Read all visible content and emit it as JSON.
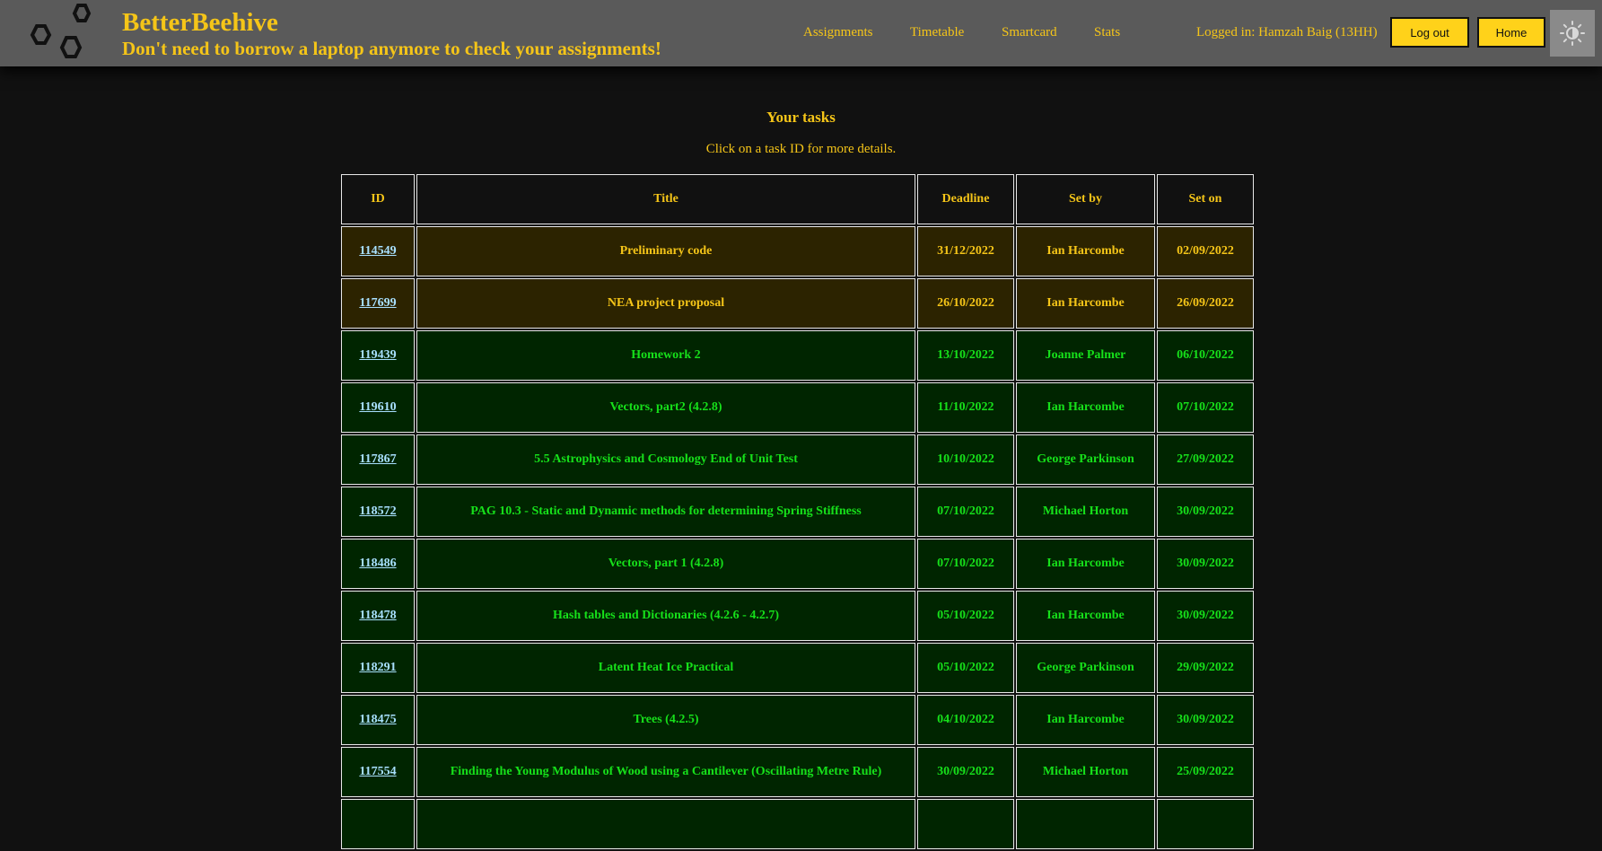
{
  "header": {
    "title": "BetterBeehive",
    "subtitle": "Don't need to borrow a laptop anymore to check your assignments!",
    "logo_icon": "hexagon-cluster-logo-icon",
    "nav": [
      "Assignments",
      "Timetable",
      "Smartcard",
      "Stats"
    ],
    "login_text": "Logged in: Hamzah Baig (13HH)",
    "logout_label": "Log out",
    "home_label": "Home",
    "theme_icon": "sun-moon-theme-icon"
  },
  "main": {
    "heading": "Your tasks",
    "instruction": "Click on a task ID for more details."
  },
  "table": {
    "columns": [
      "ID",
      "Title",
      "Deadline",
      "Set by",
      "Set on"
    ],
    "rows": [
      {
        "id": "114549",
        "title": "Preliminary code",
        "deadline": "31/12/2022",
        "set_by": "Ian Harcombe",
        "set_on": "02/09/2022",
        "status": "amber"
      },
      {
        "id": "117699",
        "title": "NEA project proposal",
        "deadline": "26/10/2022",
        "set_by": "Ian Harcombe",
        "set_on": "26/09/2022",
        "status": "amber"
      },
      {
        "id": "119439",
        "title": "Homework 2",
        "deadline": "13/10/2022",
        "set_by": "Joanne Palmer",
        "set_on": "06/10/2022",
        "status": "green"
      },
      {
        "id": "119610",
        "title": "Vectors, part2 (4.2.8)",
        "deadline": "11/10/2022",
        "set_by": "Ian Harcombe",
        "set_on": "07/10/2022",
        "status": "green"
      },
      {
        "id": "117867",
        "title": "5.5 Astrophysics and Cosmology End of Unit Test",
        "deadline": "10/10/2022",
        "set_by": "George Parkinson",
        "set_on": "27/09/2022",
        "status": "green"
      },
      {
        "id": "118572",
        "title": "PAG 10.3 - Static and Dynamic methods for determining Spring Stiffness",
        "deadline": "07/10/2022",
        "set_by": "Michael Horton",
        "set_on": "30/09/2022",
        "status": "green"
      },
      {
        "id": "118486",
        "title": "Vectors, part 1 (4.2.8)",
        "deadline": "07/10/2022",
        "set_by": "Ian Harcombe",
        "set_on": "30/09/2022",
        "status": "green"
      },
      {
        "id": "118478",
        "title": "Hash tables and Dictionaries (4.2.6 - 4.2.7)",
        "deadline": "05/10/2022",
        "set_by": "Ian Harcombe",
        "set_on": "30/09/2022",
        "status": "green"
      },
      {
        "id": "118291",
        "title": "Latent Heat Ice Practical",
        "deadline": "05/10/2022",
        "set_by": "George Parkinson",
        "set_on": "29/09/2022",
        "status": "green"
      },
      {
        "id": "118475",
        "title": "Trees (4.2.5)",
        "deadline": "04/10/2022",
        "set_by": "Ian Harcombe",
        "set_on": "30/09/2022",
        "status": "green"
      },
      {
        "id": "117554",
        "title": "Finding the Young Modulus of Wood using a Cantilever (Oscillating Metre Rule)",
        "deadline": "30/09/2022",
        "set_by": "Michael Horton",
        "set_on": "25/09/2022",
        "status": "green"
      },
      {
        "id": "",
        "title": "",
        "deadline": "",
        "set_by": "",
        "set_on": "",
        "status": "green"
      }
    ]
  }
}
